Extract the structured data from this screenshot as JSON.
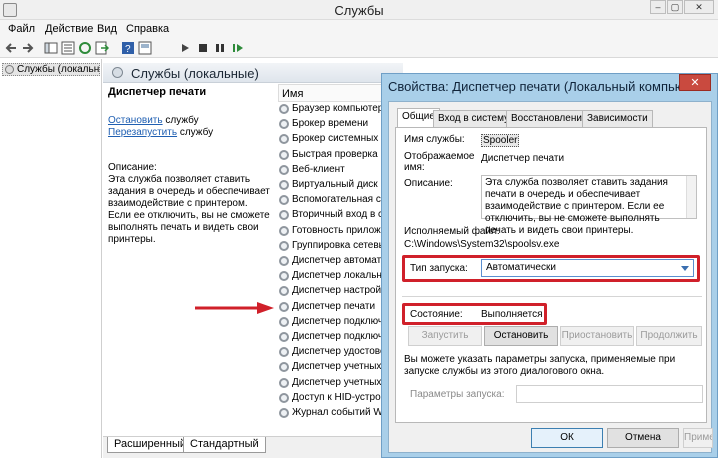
{
  "window": {
    "title": "Службы",
    "buttons": [
      "–",
      "▢",
      "✕"
    ]
  },
  "menu": [
    "Файл",
    "Действие",
    "Вид",
    "Справка"
  ],
  "tree": {
    "item": "Службы (локальные)"
  },
  "pane": {
    "header": "Службы (локальные)",
    "selected_service": "Диспетчер печати",
    "stop_link": "Остановить",
    "stop_suffix": " службу",
    "restart_link": "Перезапустить",
    "restart_suffix": " службу",
    "description_label": "Описание:",
    "description_text": "Эта служба позволяет ставить задания в очередь и обеспечивает взаимодействие с принтером. Если ее отключить, вы не сможете выполнять печать и видеть свои принтеры.",
    "column_name": "Имя"
  },
  "services": [
    "Браузер компьютеров",
    "Брокер времени",
    "Брокер системных событий",
    "Быстрая проверка",
    "Веб-клиент",
    "Виртуальный диск",
    "Вспомогательная служба IP",
    "Вторичный вход в систему",
    "Готовность приложений",
    "Группировка сетевых участников",
    "Диспетчер автоматических подключений",
    "Диспетчер локальных сеансов",
    "Диспетчер настройки устройств",
    "Диспетчер печати",
    "Диспетчер подключений",
    "Диспетчер подключений удаленного доступа",
    "Диспетчер удостоверения",
    "Диспетчер учетных данных",
    "Диспетчер учетных записей",
    "Доступ к HID-устройствам",
    "Журнал событий Windows"
  ],
  "bottom_tabs": [
    "Расширенный",
    "Стандартный"
  ],
  "dialog": {
    "title": "Свойства: Диспетчер печати (Локальный компьютер)",
    "close": "✕",
    "tabs": [
      "Общие",
      "Вход в систему",
      "Восстановление",
      "Зависимости"
    ],
    "service_name_label": "Имя службы:",
    "service_name": "Spooler",
    "display_name_label": "Отображаемое имя:",
    "display_name": "Диспетчер печати",
    "description_label": "Описание:",
    "description": "Эта служба позволяет ставить задания печати в очередь и обеспечивает взаимодействие с принтером. Если ее отключить, вы не сможете выполнять печать и видеть свои принтеры.",
    "exe_label": "Исполняемый файл:",
    "exe_path": "C:\\Windows\\System32\\spoolsv.exe",
    "startup_label": "Тип запуска:",
    "startup_value": "Автоматически",
    "state_label": "Состояние:",
    "state_value": "Выполняется",
    "buttons": {
      "start": "Запустить",
      "stop": "Остановить",
      "pause": "Приостановить",
      "resume": "Продолжить"
    },
    "hint": "Вы можете указать параметры запуска, применяемые при запуске службы из этого диалогового окна.",
    "params_label": "Параметры запуска:",
    "ok": "ОК",
    "cancel": "Отмена",
    "apply": "Применить"
  },
  "colors": {
    "highlight_box": "#d0202a",
    "arrow": "#d0202a",
    "dialog_frame": "#a9cfe9",
    "link": "#1f5fb2"
  }
}
